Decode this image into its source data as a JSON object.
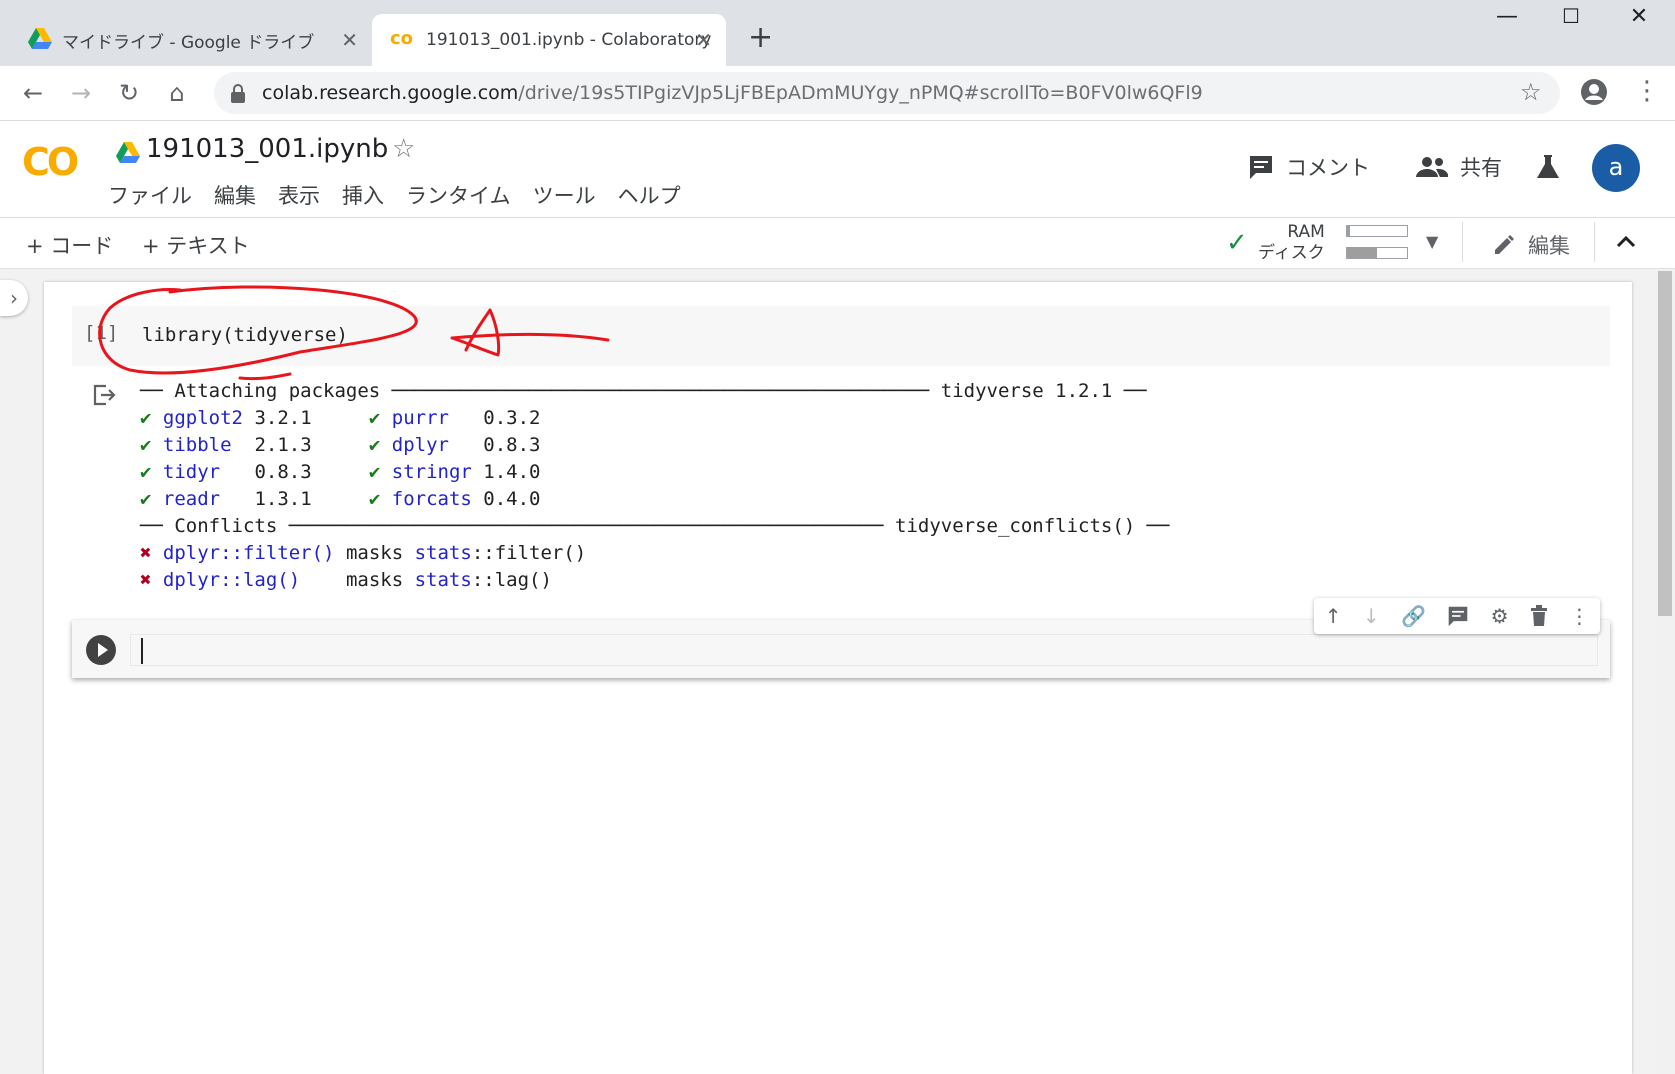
{
  "browser": {
    "tabs": [
      {
        "title": "マイドライブ - Google ドライブ",
        "active": false
      },
      {
        "title": "191013_001.ipynb - Colaboratory",
        "active": true
      }
    ],
    "url_host": "colab.research.google.com",
    "url_path": "/drive/19s5TIPgizVJp5LjFBEpADmMUYgy_nPMQ#scrollTo=B0FV0lw6QFl9"
  },
  "colab": {
    "logo": "CO",
    "notebook_title": "191013_001.ipynb",
    "menu": [
      "ファイル",
      "編集",
      "表示",
      "挿入",
      "ランタイム",
      "ツール",
      "ヘルプ"
    ],
    "comment_label": "コメント",
    "share_label": "共有",
    "avatar_letter": "a"
  },
  "cell_toolbar": {
    "add_code": "+ コード",
    "add_text": "+ テキスト",
    "ram_label": "RAM",
    "disk_label": "ディスク",
    "ram_usage": 0.05,
    "disk_usage": 0.5,
    "edit_label": "編集"
  },
  "cells": {
    "cell1": {
      "exec_count": "[1]",
      "code": "library(tidyverse)",
      "output": {
        "attaching_left": "── Attaching packages ───────────────────────────────────────────────",
        "attaching_right": "tidyverse 1.2.1 ──",
        "packages": [
          [
            {
              "name": "ggplot2",
              "pad": " ",
              "version": "3.2.1"
            },
            {
              "name": "purrr",
              "pad": "   ",
              "version": "0.3.2"
            }
          ],
          [
            {
              "name": "tibble",
              "pad": "  ",
              "version": "2.1.3"
            },
            {
              "name": "dplyr",
              "pad": "   ",
              "version": "0.8.3"
            }
          ],
          [
            {
              "name": "tidyr",
              "pad": "   ",
              "version": "0.8.3"
            },
            {
              "name": "stringr",
              "pad": " ",
              "version": "1.4.0"
            }
          ],
          [
            {
              "name": "readr",
              "pad": "   ",
              "version": "1.3.1"
            },
            {
              "name": "forcats",
              "pad": " ",
              "version": "0.4.0"
            }
          ]
        ],
        "conflicts_left": "── Conflicts ────────────────────────────────────────────────────",
        "conflicts_right": "tidyverse_conflicts() ──",
        "conflicts": [
          {
            "pkg": "dplyr",
            "fn": "::filter()",
            "pad": " ",
            "masks": "masks",
            "by_pkg": "stats",
            "by_fn": "::filter()"
          },
          {
            "pkg": "dplyr",
            "fn": "::lag()",
            "pad": "    ",
            "masks": "masks",
            "by_pkg": "stats",
            "by_fn": "::lag()"
          }
        ]
      }
    }
  },
  "colors": {
    "check": "#1b7b1b",
    "cross": "#b00020",
    "package_name": "#2222cc",
    "avatar": "#1a5da6",
    "annotation": "#e8161c",
    "logo": "#f9ab00"
  }
}
